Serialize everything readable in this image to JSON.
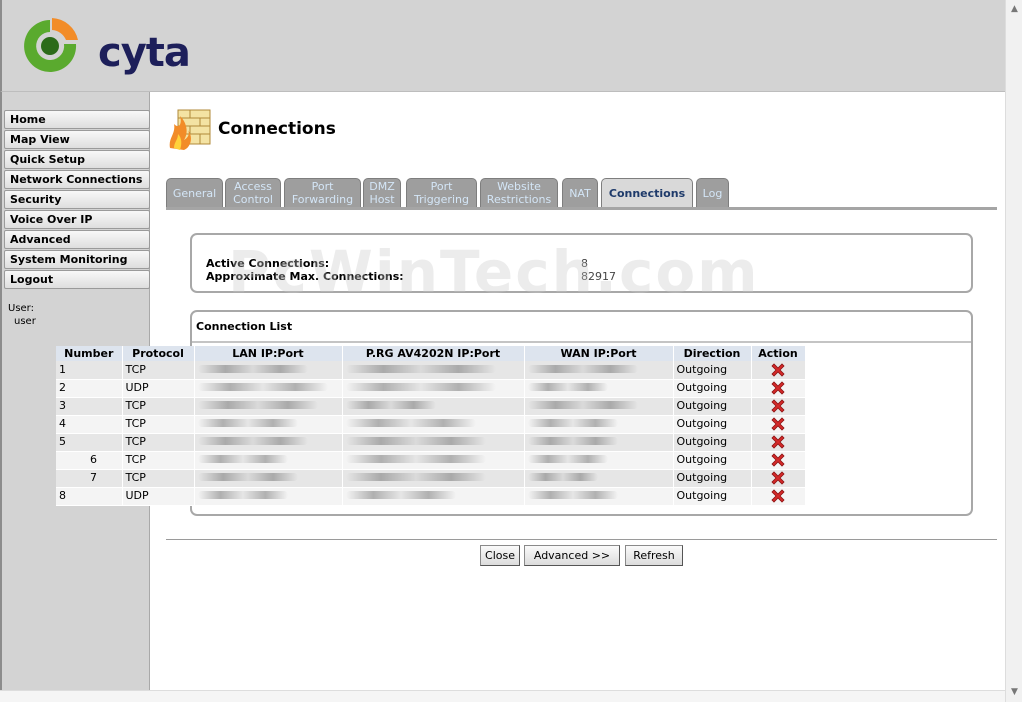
{
  "brand": {
    "name": "cyta",
    "colors": {
      "green": "#5aaa2e",
      "orange": "#f28c28",
      "navy": "#1d1f5a"
    }
  },
  "sidebar": {
    "items": [
      {
        "label": "Home"
      },
      {
        "label": "Map View"
      },
      {
        "label": "Quick Setup"
      },
      {
        "label": "Network Connections"
      },
      {
        "label": "Security"
      },
      {
        "label": "Voice Over IP"
      },
      {
        "label": "Advanced"
      },
      {
        "label": "System Monitoring"
      },
      {
        "label": "Logout"
      }
    ],
    "user_label": "User:",
    "user_name": "user"
  },
  "page": {
    "title": "Connections",
    "title_icon": "firewall-icon"
  },
  "tabs": [
    {
      "line1": "General",
      "line2": ""
    },
    {
      "line1": "Access",
      "line2": "Control"
    },
    {
      "line1": "Port",
      "line2": "Forwarding"
    },
    {
      "line1": "DMZ",
      "line2": "Host"
    },
    {
      "line1": "Port",
      "line2": "Triggering"
    },
    {
      "line1": "Website",
      "line2": "Restrictions"
    },
    {
      "line1": "NAT",
      "line2": ""
    },
    {
      "line1": "Connections",
      "line2": "",
      "active": true
    },
    {
      "line1": "Log",
      "line2": ""
    }
  ],
  "status": {
    "active_label": "Active Connections:",
    "active_value": "8",
    "max_label": "Approximate Max. Connections:",
    "max_value": "82917"
  },
  "watermark": "PcWinTech.com",
  "connection_list": {
    "title": "Connection List",
    "columns": [
      "Number",
      "Protocol",
      "LAN IP:Port",
      "P.RG AV4202N IP:Port",
      "WAN IP:Port",
      "Direction",
      "Action"
    ],
    "rows": [
      {
        "number": "1",
        "protocol": "TCP",
        "direction": "Outgoing"
      },
      {
        "number": "2",
        "protocol": "UDP",
        "direction": "Outgoing"
      },
      {
        "number": "3",
        "protocol": "TCP",
        "direction": "Outgoing"
      },
      {
        "number": "4",
        "protocol": "TCP",
        "direction": "Outgoing"
      },
      {
        "number": "5",
        "protocol": "TCP",
        "direction": "Outgoing"
      },
      {
        "number": "6",
        "protocol": "TCP",
        "direction": "Outgoing"
      },
      {
        "number": "7",
        "protocol": "TCP",
        "direction": "Outgoing"
      },
      {
        "number": "8",
        "protocol": "UDP",
        "direction": "Outgoing"
      }
    ],
    "action_icon": "delete-x-icon"
  },
  "buttons": {
    "close": "Close",
    "advanced": "Advanced >>",
    "refresh": "Refresh"
  }
}
